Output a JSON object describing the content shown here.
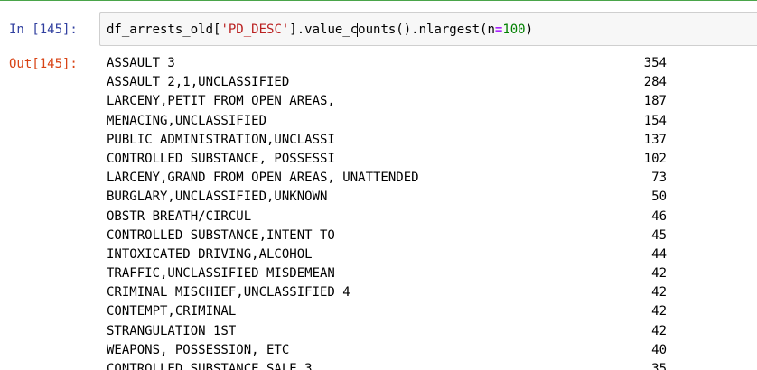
{
  "input_prompt": "In [145]:",
  "output_prompt": "Out[145]:",
  "code": {
    "prefix": "df_arrests_old[",
    "string": "'PD_DESC'",
    "middle_before_cursor": "].value_c",
    "middle_after_cursor": "ounts().nlargest(",
    "kwarg": "n",
    "op": "=",
    "number": "100",
    "suffix": ")"
  },
  "output_rows": [
    {
      "desc": "ASSAULT 3",
      "count": "354"
    },
    {
      "desc": "ASSAULT 2,1,UNCLASSIFIED",
      "count": "284"
    },
    {
      "desc": "LARCENY,PETIT FROM OPEN AREAS,",
      "count": "187"
    },
    {
      "desc": "MENACING,UNCLASSIFIED",
      "count": "154"
    },
    {
      "desc": "PUBLIC ADMINISTRATION,UNCLASSI",
      "count": "137"
    },
    {
      "desc": "CONTROLLED SUBSTANCE, POSSESSI",
      "count": "102"
    },
    {
      "desc": "LARCENY,GRAND FROM OPEN AREAS, UNATTENDED",
      "count": "73"
    },
    {
      "desc": "BURGLARY,UNCLASSIFIED,UNKNOWN",
      "count": "50"
    },
    {
      "desc": "OBSTR BREATH/CIRCUL",
      "count": "46"
    },
    {
      "desc": "CONTROLLED SUBSTANCE,INTENT TO",
      "count": "45"
    },
    {
      "desc": "INTOXICATED DRIVING,ALCOHOL",
      "count": "44"
    },
    {
      "desc": "TRAFFIC,UNCLASSIFIED MISDEMEAN",
      "count": "42"
    },
    {
      "desc": "CRIMINAL MISCHIEF,UNCLASSIFIED 4",
      "count": "42"
    },
    {
      "desc": "CONTEMPT,CRIMINAL",
      "count": "42"
    },
    {
      "desc": "STRANGULATION 1ST",
      "count": "42"
    },
    {
      "desc": "WEAPONS, POSSESSION, ETC",
      "count": "40"
    },
    {
      "desc": "CONTROLLED SUBSTANCE,SALE 3",
      "count": "35"
    }
  ]
}
